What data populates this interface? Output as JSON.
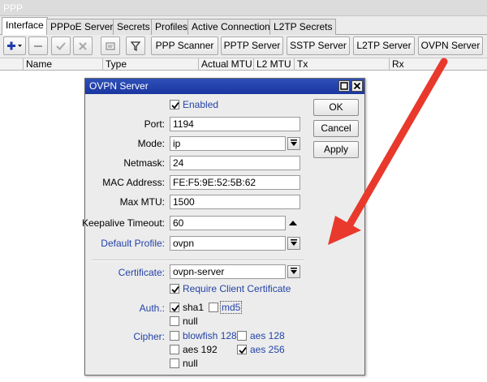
{
  "window": {
    "title": "PPP"
  },
  "tabs": [
    {
      "label": "Interface"
    },
    {
      "label": "PPPoE Servers"
    },
    {
      "label": "Secrets"
    },
    {
      "label": "Profiles"
    },
    {
      "label": "Active Connections"
    },
    {
      "label": "L2TP Secrets"
    }
  ],
  "toolbar": {
    "ppp_scanner": "PPP Scanner",
    "pptp_server": "PPTP Server",
    "sstp_server": "SSTP Server",
    "l2tp_server": "L2TP Server",
    "ovpn_server": "OVPN Server"
  },
  "columns": [
    "Name",
    "Type",
    "Actual MTU",
    "L2 MTU",
    "Tx",
    "Rx"
  ],
  "dialog": {
    "title": "OVPN Server",
    "enabled_label": "Enabled",
    "port_label": "Port:",
    "port_value": "1194",
    "mode_label": "Mode:",
    "mode_value": "ip",
    "netmask_label": "Netmask:",
    "netmask_value": "24",
    "mac_label": "MAC Address:",
    "mac_value": "FE:F5:9E:52:5B:62",
    "mtu_label": "Max MTU:",
    "mtu_value": "1500",
    "keepalive_label": "Keepalive Timeout:",
    "keepalive_value": "60",
    "profile_label": "Default Profile:",
    "profile_value": "ovpn",
    "cert_label": "Certificate:",
    "cert_value": "ovpn-server",
    "require_cert_label": "Require Client Certificate",
    "auth_label": "Auth.:",
    "auth_options": [
      "sha1",
      "md5",
      "null"
    ],
    "cipher_label": "Cipher:",
    "cipher_options": [
      "blowfish 128",
      "aes 128",
      "aes 192",
      "aes 256",
      "null"
    ],
    "ok": "OK",
    "cancel": "Cancel",
    "apply": "Apply"
  },
  "colors": {
    "dialog_title_bg": "#1f3ba6",
    "field_label_blue": "#2443a8",
    "annotation_arrow": "#e8392c"
  },
  "icons": [
    "add-icon",
    "remove-icon",
    "enable-icon",
    "disable-icon",
    "comment-icon",
    "filter-icon",
    "maximize-icon",
    "close-icon",
    "dropdown-icon",
    "spin-up-icon",
    "checkmark-icon",
    "annotation-arrow"
  ]
}
